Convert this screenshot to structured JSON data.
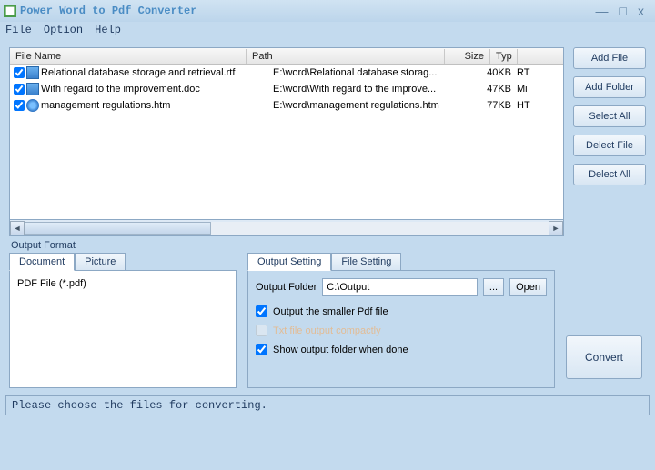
{
  "title": "Power Word to Pdf Converter",
  "menu": {
    "file": "File",
    "option": "Option",
    "help": "Help"
  },
  "headers": {
    "filename": "File Name",
    "path": "Path",
    "size": "Size",
    "type": "Typ"
  },
  "files": [
    {
      "name": "Relational database storage and retrieval.rtf",
      "path": "E:\\word\\Relational database storag...",
      "size": "40KB",
      "type": "RT"
    },
    {
      "name": "With regard to the improvement.doc",
      "path": "E:\\word\\With regard to the improve...",
      "size": "47KB",
      "type": "Mi"
    },
    {
      "name": "management regulations.htm",
      "path": "E:\\word\\management regulations.htm",
      "size": "77KB",
      "type": "HT"
    }
  ],
  "buttons": {
    "addfile": "Add File",
    "addfolder": "Add Folder",
    "selectall": "Select All",
    "delectfile": "Delect File",
    "delectall": "Delect All"
  },
  "outputFormatLabel": "Output Format",
  "fmtTabs": {
    "document": "Document",
    "picture": "Picture"
  },
  "fmtContent": "PDF File  (*.pdf)",
  "settingTabs": {
    "output": "Output Setting",
    "file": "File Setting"
  },
  "outputFolderLabel": "Output Folder",
  "outputFolderValue": "C:\\Output",
  "browse": "...",
  "open": "Open",
  "chk1": "Output the smaller Pdf file",
  "chk2": "Txt file output compactly",
  "chk3": "Show output folder when done",
  "convert": "Convert",
  "status": "Please choose the files for converting."
}
